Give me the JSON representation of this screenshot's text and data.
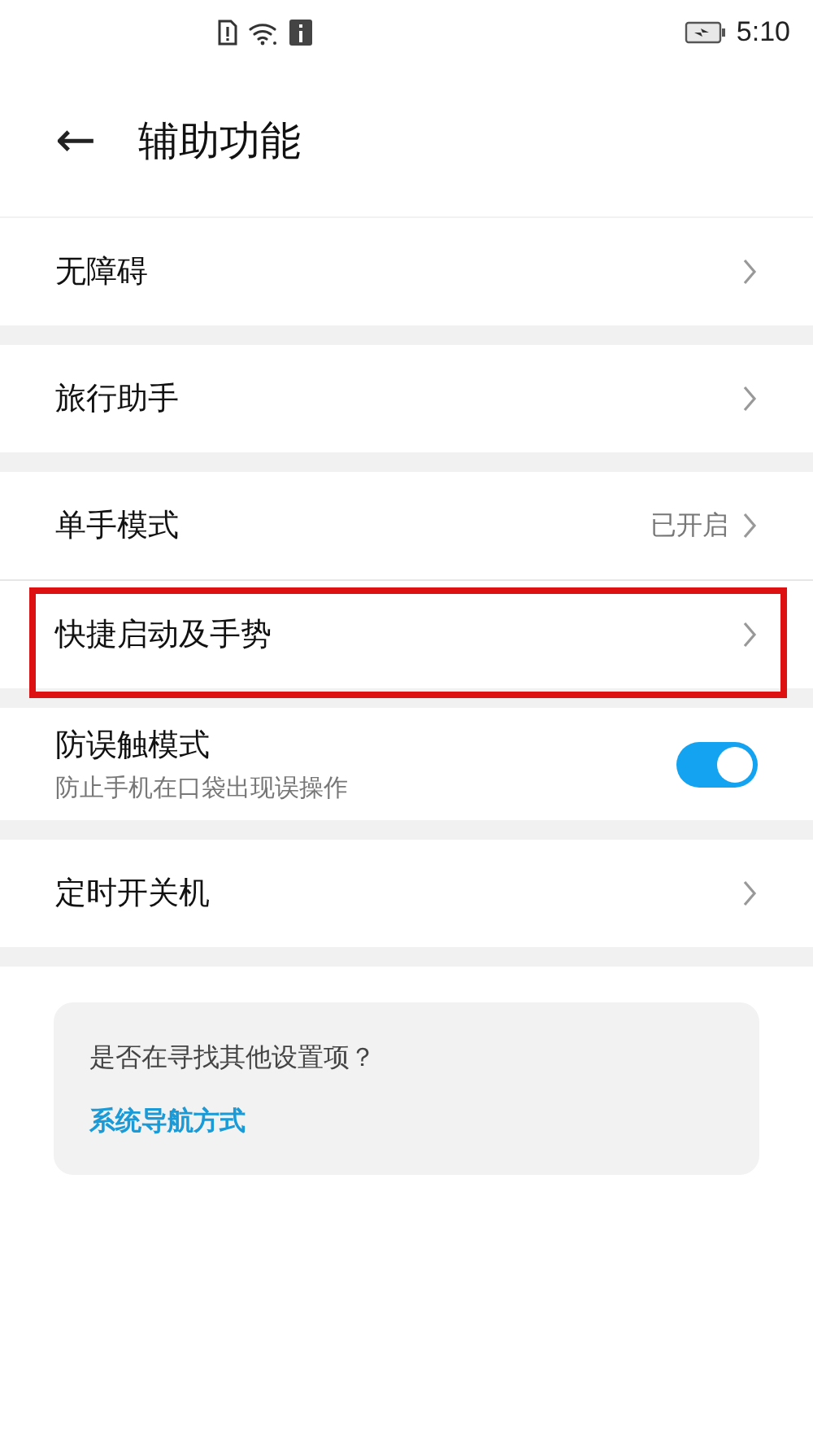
{
  "status_bar": {
    "time": "5:10"
  },
  "header": {
    "back": "←",
    "title": "辅助功能"
  },
  "groups": [
    {
      "items": [
        {
          "kind": "link",
          "label": "无障碍",
          "highlighted": false
        }
      ]
    },
    {
      "items": [
        {
          "kind": "link",
          "label": "旅行助手",
          "highlighted": false
        }
      ]
    },
    {
      "items": [
        {
          "kind": "link",
          "label": "单手模式",
          "value": "已开启",
          "highlighted": false
        },
        {
          "kind": "link",
          "label": "快捷启动及手势",
          "highlighted": true
        }
      ]
    },
    {
      "items": [
        {
          "kind": "toggle",
          "label": "防误触模式",
          "subtitle": "防止手机在口袋出现误操作",
          "on": true,
          "highlighted": false
        }
      ]
    },
    {
      "items": [
        {
          "kind": "link",
          "label": "定时开关机",
          "highlighted": false
        }
      ]
    }
  ],
  "suggestion": {
    "question": "是否在寻找其他设置项？",
    "link": "系统导航方式"
  }
}
